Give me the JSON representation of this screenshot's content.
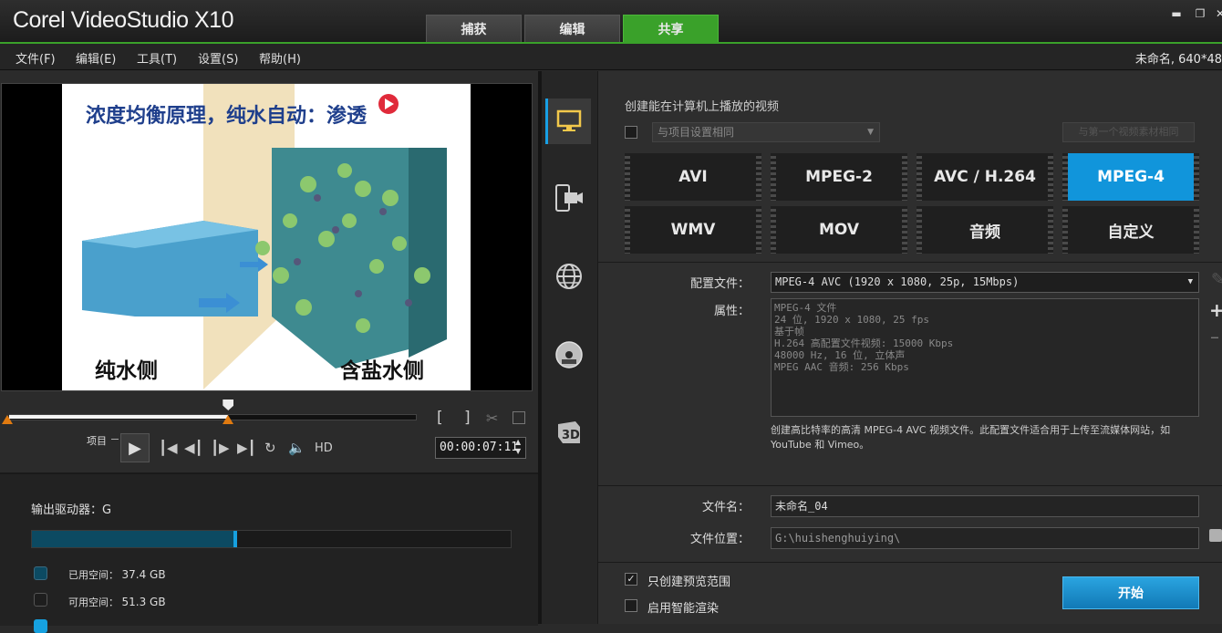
{
  "app": {
    "logo": "Corel VideoStudio X10",
    "project_info": "未命名, 640*48"
  },
  "tabs": [
    {
      "label": "捕获"
    },
    {
      "label": "编辑"
    },
    {
      "label": "共享"
    }
  ],
  "window_controls": [
    "minimize-icon",
    "restore-icon",
    "close-icon"
  ],
  "menu": [
    "文件(F)",
    "编辑(E)",
    "工具(T)",
    "设置(S)",
    "帮助(H)"
  ],
  "preview": {
    "frame_text": {
      "title": "浓度均衡原理，纯水自动：渗透",
      "left_label": "纯水侧",
      "right_label": "含盐水侧"
    },
    "project_label": "项目",
    "hd_label": "HD",
    "timecode": "00:00:07:11",
    "scrub_progress": 0.54
  },
  "drive": {
    "label": "输出驱动器：G",
    "used_fraction": 0.42,
    "legend": [
      {
        "label": "已用空间：",
        "value": "37.4 GB",
        "color": "#0c4a62"
      },
      {
        "label": "可用空间：",
        "value": "51.3 GB",
        "color": "#2a2a2a"
      },
      {
        "label": "",
        "value": "",
        "color": "#16a1e0"
      }
    ]
  },
  "side_icons": [
    "computer-icon",
    "device-icon",
    "web-icon",
    "disc-icon",
    "3d-icon"
  ],
  "share": {
    "title": "创建能在计算机上播放的视频",
    "same_as_project": "与项目设置相同",
    "ghost_button": "与第一个视频素材相同",
    "formats": [
      "AVI",
      "MPEG-2",
      "AVC / H.264",
      "MPEG-4",
      "WMV",
      "MOV",
      "音频",
      "自定义"
    ],
    "active_format": "MPEG-4",
    "profile_label": "配置文件：",
    "profile_value": "MPEG-4 AVC (1920 x 1080, 25p, 15Mbps)",
    "attr_label": "属性：",
    "attributes": [
      "MPEG-4 文件",
      "24 位, 1920 x 1080, 25 fps",
      "基于帧",
      "H.264 高配置文件视频: 15000 Kbps",
      "48000 Hz, 16 位, 立体声",
      "MPEG AAC 音频: 256 Kbps"
    ],
    "description": "创建高比特率的高清 MPEG-4 AVC 视频文件。此配置文件适合用于上传至流媒体网站，如 YouTube 和 Vimeo。",
    "filename_label": "文件名：",
    "filename_value": "未命名_04",
    "location_label": "文件位置：",
    "location_value": "G:\\huishenghuiying\\",
    "preview_range_label": "只创建预览范围",
    "smart_render_label": "启用智能渲染",
    "start_button": "开始"
  }
}
